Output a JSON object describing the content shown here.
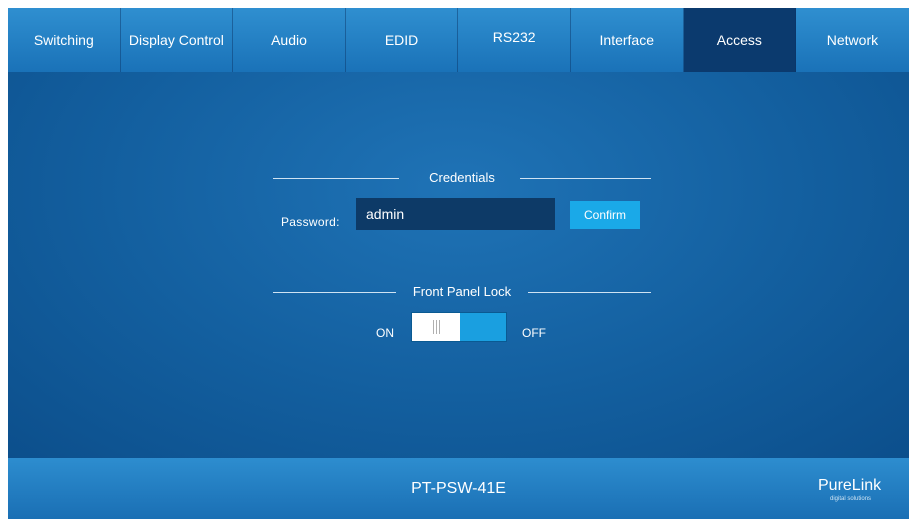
{
  "nav": {
    "tabs": [
      {
        "label": "Switching",
        "active": false
      },
      {
        "label": "Display Control",
        "active": false
      },
      {
        "label": "Audio",
        "active": false
      },
      {
        "label": "EDID",
        "active": false
      },
      {
        "label": "RS232",
        "active": false
      },
      {
        "label": "Interface",
        "active": false
      },
      {
        "label": "Access",
        "active": true
      },
      {
        "label": "Network",
        "active": false
      }
    ]
  },
  "credentials": {
    "title": "Credentials",
    "password_label": "Password:",
    "password_value": "admin",
    "confirm_label": "Confirm"
  },
  "front_panel_lock": {
    "title": "Front Panel Lock",
    "on_label": "ON",
    "off_label": "OFF",
    "state": "ON"
  },
  "footer": {
    "model": "PT-PSW-41E",
    "logo_text": "PureLink",
    "logo_tagline": "digital solutions"
  },
  "colors": {
    "nav_bg": "#1f80c4",
    "active_tab": "#0b3a6e",
    "main_bg": "#135f9f",
    "accent": "#1aa9e8",
    "input_bg": "#0d3a67"
  }
}
